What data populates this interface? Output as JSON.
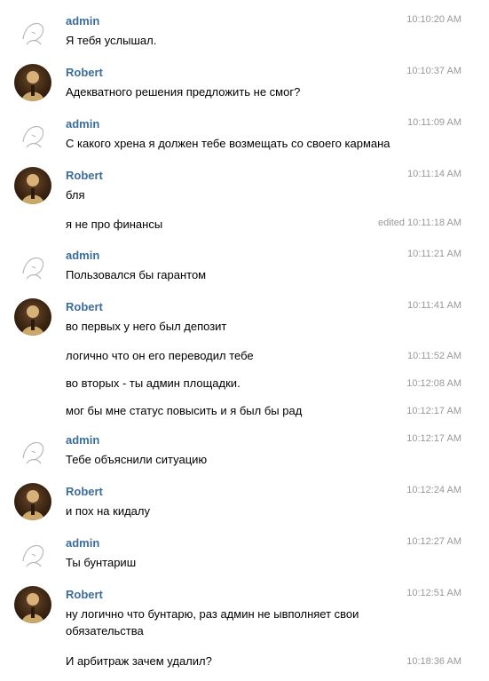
{
  "messages": [
    {
      "author": "admin",
      "time": "10:10:20 AM",
      "text": "Я тебя услышал."
    },
    {
      "author": "Robert",
      "time": "10:10:37 AM",
      "text": "Адекватного решения предложить не смог?"
    },
    {
      "author": "admin",
      "time": "10:11:09 AM",
      "text": "С какого хрена я должен тебе возмещать со своего кармана"
    },
    {
      "author": "Robert",
      "time": "10:11:14 AM",
      "text": "бля"
    },
    {
      "author": "",
      "time": "edited 10:11:18 AM",
      "text": "я не про финансы"
    },
    {
      "author": "admin",
      "time": "10:11:21 AM",
      "text": "Пользовался бы гарантом"
    },
    {
      "author": "Robert",
      "time": "10:11:41 AM",
      "text": "во первых у него был депозит"
    },
    {
      "author": "",
      "time": "10:11:52 AM",
      "text": "логично что он его переводил тебе"
    },
    {
      "author": "",
      "time": "10:12:08 AM",
      "text": "во вторых - ты админ площадки."
    },
    {
      "author": "",
      "time": "10:12:17 AM",
      "text": "мог бы мне статус повысить и я был бы рад"
    },
    {
      "author": "admin",
      "time": "10:12:17 AM",
      "text": "Тебе объяснили ситуацию"
    },
    {
      "author": "Robert",
      "time": "10:12:24 AM",
      "text": "и пох на кидалу"
    },
    {
      "author": "admin",
      "time": "10:12:27 AM",
      "text": "Ты бунтариш"
    },
    {
      "author": "Robert",
      "time": "10:12:51 AM",
      "text": "ну логично что бунтарю, раз админ не ывполняет свои обязательства"
    },
    {
      "author": "",
      "time": "10:18:36 AM",
      "text": "И арбитраж зачем удалил?"
    }
  ],
  "colors": {
    "author": "#3a6d99",
    "time": "#999999",
    "text": "#000000"
  }
}
